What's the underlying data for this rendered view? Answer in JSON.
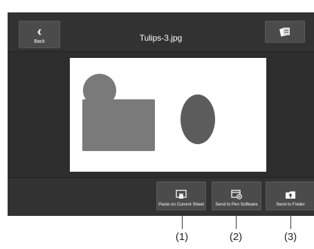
{
  "header": {
    "back_label": "Back",
    "title": "Tulips-3.jpg",
    "tool_icon": "document-send-icon"
  },
  "actions": [
    {
      "label": "Paste on Current Sheet",
      "icon": "paste-sheet-icon"
    },
    {
      "label": "Send to Pen Software",
      "icon": "send-pen-icon"
    },
    {
      "label": "Send to Folder",
      "icon": "send-folder-icon"
    }
  ],
  "callouts": [
    "(1)",
    "(2)",
    "(3)"
  ],
  "colors": {
    "bar": "#323232",
    "button": "#4b4b4b",
    "shape": "#7a7a7a",
    "ellipse": "#5c5c5c"
  }
}
